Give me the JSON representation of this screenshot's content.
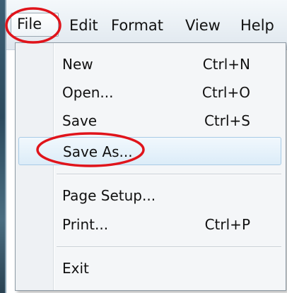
{
  "menubar": {
    "items": [
      {
        "label": "File"
      },
      {
        "label": "Edit"
      },
      {
        "label": "Format"
      },
      {
        "label": "View"
      },
      {
        "label": "Help"
      }
    ]
  },
  "file_menu": {
    "items": [
      {
        "label": "New",
        "shortcut": "Ctrl+N"
      },
      {
        "label": "Open...",
        "shortcut": "Ctrl+O"
      },
      {
        "label": "Save",
        "shortcut": "Ctrl+S"
      },
      {
        "label": "Save As...",
        "shortcut": "",
        "highlighted": true
      },
      {
        "label": "Page Setup...",
        "shortcut": ""
      },
      {
        "label": "Print...",
        "shortcut": "Ctrl+P"
      },
      {
        "label": "Exit",
        "shortcut": ""
      }
    ]
  },
  "annotation": {
    "color": "#e0141b",
    "circled": [
      "File",
      "Save As..."
    ]
  }
}
